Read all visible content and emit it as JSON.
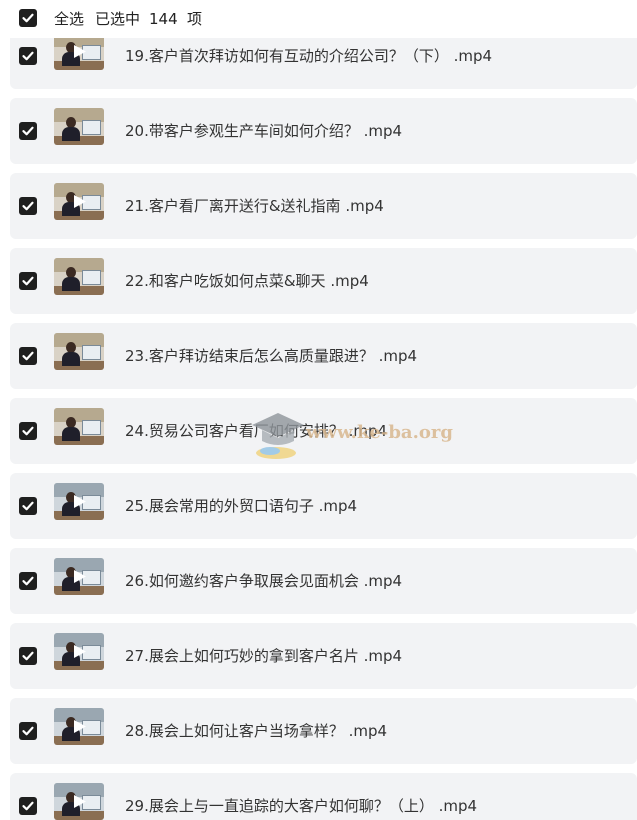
{
  "header": {
    "select_all_label": "全选",
    "selected_label": "已选中",
    "selected_count": "144",
    "selected_unit": "项"
  },
  "files": [
    {
      "title": "19.客户首次拜访如何有互动的介绍公司？（下） .mp4",
      "checked": true
    },
    {
      "title": "20.带客户参观生产车间如何介绍？ .mp4",
      "checked": true
    },
    {
      "title": "21.客户看厂离开送行&送礼指南 .mp4",
      "checked": true
    },
    {
      "title": "22.和客户吃饭如何点菜&聊天 .mp4",
      "checked": true
    },
    {
      "title": "23.客户拜访结束后怎么高质量跟进？ .mp4",
      "checked": true
    },
    {
      "title": "24.贸易公司客户看厂如何安排？ .mp4",
      "checked": true
    },
    {
      "title": "25.展会常用的外贸口语句子 .mp4",
      "checked": true
    },
    {
      "title": "26.如何邀约客户争取展会见面机会 .mp4",
      "checked": true
    },
    {
      "title": "27.展会上如何巧妙的拿到客户名片 .mp4",
      "checked": true
    },
    {
      "title": "28.展会上如何让客户当场拿样？ .mp4",
      "checked": true
    },
    {
      "title": "29.展会上与一直追踪的大客户如何聊？（上） .mp4",
      "checked": true
    }
  ],
  "watermark": {
    "text": "www.ke-ba.org",
    "icon": "graduation-cap-icon"
  },
  "colors": {
    "row_background": "#f2f3f5",
    "checkbox": "#1f1f1f",
    "text": "#333333"
  }
}
